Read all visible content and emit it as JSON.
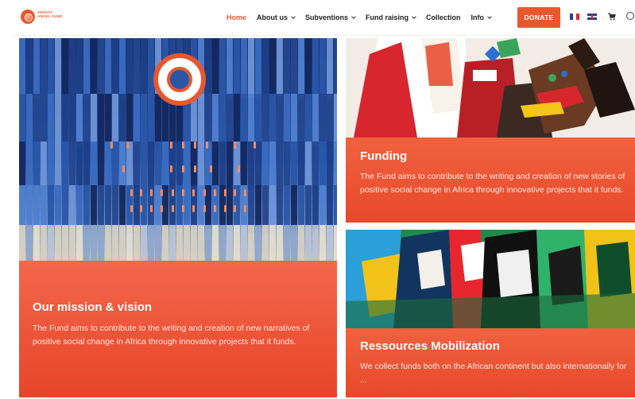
{
  "header": {
    "logo_text": "SENSAT ANGEL FUND",
    "nav": [
      {
        "label": "Home",
        "active": true,
        "dropdown": false
      },
      {
        "label": "About us",
        "active": false,
        "dropdown": true
      },
      {
        "label": "Subventions",
        "active": false,
        "dropdown": true
      },
      {
        "label": "Fund raising",
        "active": false,
        "dropdown": true
      },
      {
        "label": "Collection",
        "active": false,
        "dropdown": false
      },
      {
        "label": "Info",
        "active": false,
        "dropdown": true
      }
    ],
    "donate_label": "DONATE",
    "icons": [
      "flag-fr-icon",
      "flag-uk-icon",
      "cart-icon",
      "search-icon"
    ]
  },
  "cards": {
    "mission": {
      "title": "Our mission & vision",
      "text": "The Fund aims to contribute to the writing and creation of new narratives of positive social change in Africa through innovative projects that it funds."
    },
    "funding": {
      "title": "Funding",
      "text": "The Fund aims to contribute to the writing and creation of new stories of positive social change in Africa through innovative projects that it funds."
    },
    "resources": {
      "title": "Ressources Mobilization",
      "text": "We collect funds both on the African continent but also internationally for ..."
    }
  },
  "colors": {
    "accent": "#e8582e",
    "panel": "#ec5232",
    "nav_text": "#222222"
  }
}
